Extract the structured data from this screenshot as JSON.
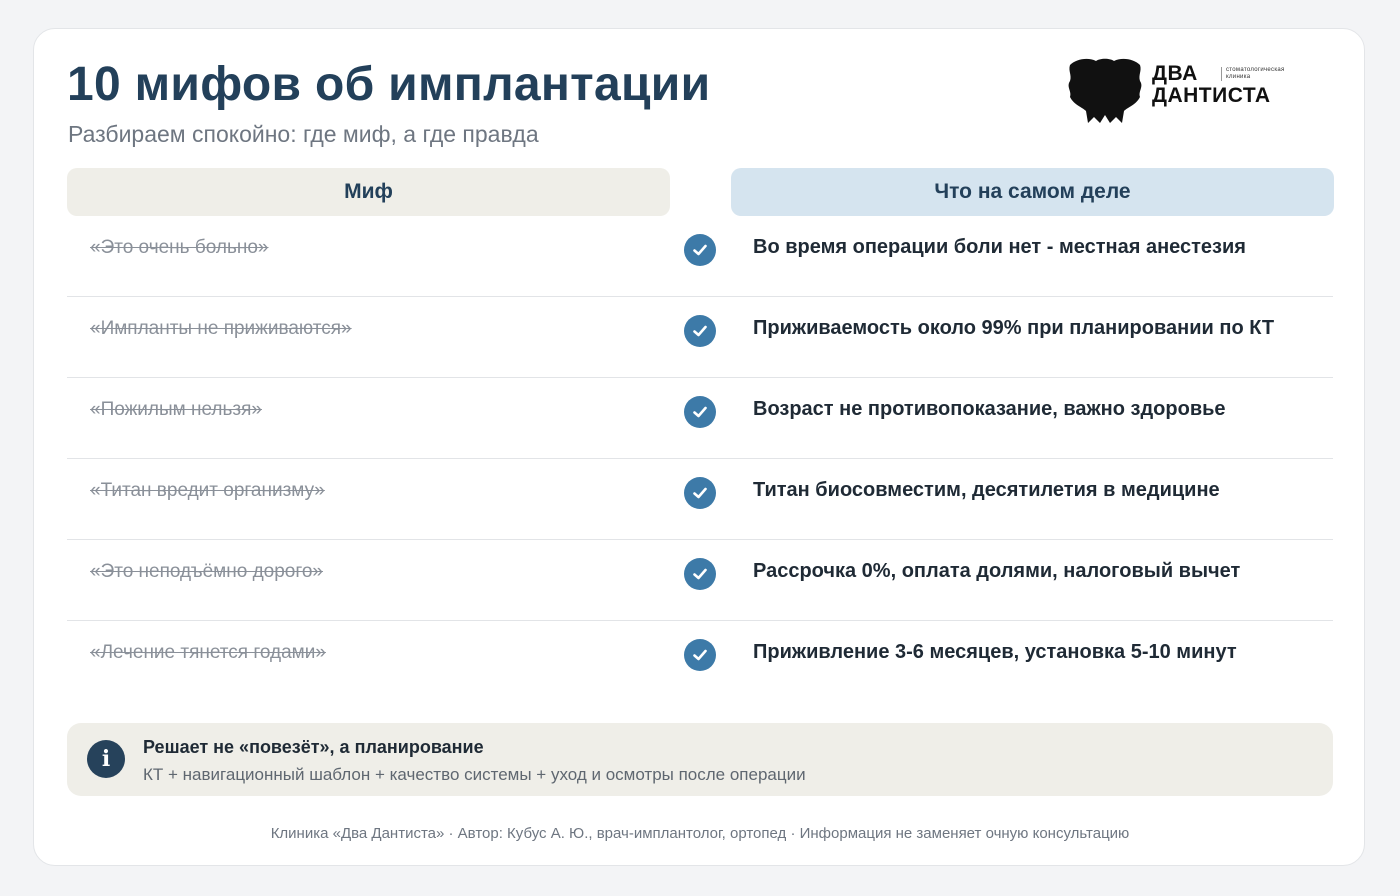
{
  "header": {
    "title": "10 мифов об имплантации",
    "subtitle": "Разбираем спокойно: где миф, а где правда"
  },
  "logo": {
    "name_line1": "ДВА",
    "name_line2": "ДАНТИСТА",
    "tag_line1": "стоматологическая",
    "tag_line2": "клиника"
  },
  "columns": {
    "myth": "Миф",
    "fact": "Что на самом деле"
  },
  "rows": [
    {
      "myth": "«Это очень больно»",
      "fact": "Во время операции боли нет - местная анестезия"
    },
    {
      "myth": "«Импланты не приживаются»",
      "fact": "Приживаемость около 99% при планировании по КТ"
    },
    {
      "myth": "«Пожилым нельзя»",
      "fact": "Возраст не противопоказание, важно здоровье"
    },
    {
      "myth": "«Титан вредит организму»",
      "fact": "Титан биосовместим, десятилетия в медицине"
    },
    {
      "myth": "«Это неподъёмно дорого»",
      "fact": "Рассрочка 0%, оплата долями, налоговый вычет"
    },
    {
      "myth": "«Лечение тянется годами»",
      "fact": "Приживление 3-6 месяцев, установка 5-10 минут"
    }
  ],
  "note": {
    "icon": "info-icon",
    "icon_glyph": "i",
    "title": "Решает не «повезёт», а планирование",
    "body": "КТ + навигационный шаблон + качество системы + уход и осмотры после операции"
  },
  "footer": "Клиника «Два Дантиста» · Автор: Кубус А. Ю., врач-имплантолог, ортопед · Информация не заменяет очную консультацию",
  "colors": {
    "title": "#23405a",
    "check": "#3d7aa8",
    "myth_header_bg": "#efeee8",
    "fact_header_bg": "#d5e4ef",
    "info_icon_bg": "#26425b"
  }
}
